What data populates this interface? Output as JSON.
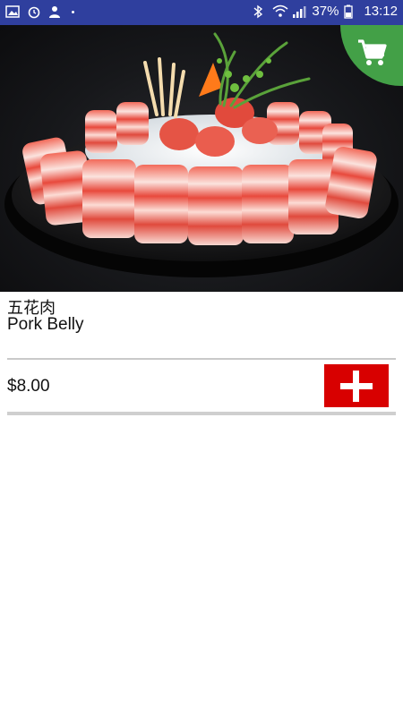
{
  "status_bar": {
    "battery": "37%",
    "time": "13:12",
    "icons": [
      "image-icon",
      "alarm-icon",
      "user-icon",
      "bluetooth-icon",
      "wifi-icon",
      "signal-icon",
      "battery-icon"
    ]
  },
  "product": {
    "name_cn": "五花肉",
    "name_en": "Pork Belly",
    "price": "$8.00"
  },
  "colors": {
    "status_bar": "#2f3f9e",
    "cart_badge": "#43a047",
    "add_button": "#d80000"
  }
}
